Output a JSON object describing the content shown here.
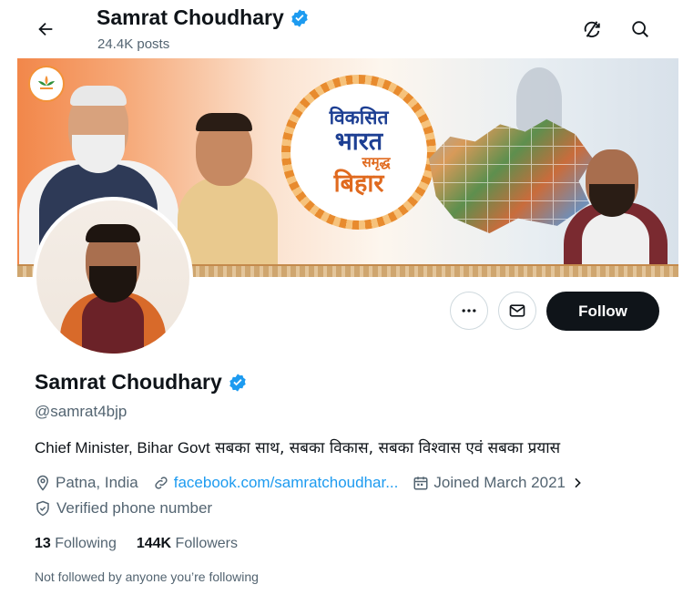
{
  "header": {
    "back_icon": "arrow-left-icon",
    "title": "Samrat Choudhary",
    "posts": "24.4K posts",
    "sync_icon": "sync-off-icon",
    "search_icon": "search-icon"
  },
  "banner": {
    "ring_line1": "विकसित",
    "ring_line2": "भारत",
    "ring_line3": "समृद्ध",
    "ring_line4": "बिहार",
    "logo_icon": "lotus-logo-icon"
  },
  "actions": {
    "more_icon": "more-dots-icon",
    "message_icon": "mail-icon",
    "follow_label": "Follow"
  },
  "profile": {
    "name": "Samrat Choudhary",
    "verified_icon": "verified-badge-icon",
    "handle": "@samrat4bjp",
    "bio_prefix": "Chief Minister, Bihar Govt",
    "bio_hindi": " सबका साथ, सबका विकास, सबका विश्वास एवं सबका प्रयास",
    "location": "Patna, India",
    "website": "facebook.com/samratchoudhar...",
    "joined": "Joined March 2021",
    "verified_phone": "Verified phone number"
  },
  "stats": {
    "following_count": "13",
    "following_label": "Following",
    "followers_count": "144K",
    "followers_label": "Followers"
  },
  "note": "Not followed by anyone you’re following",
  "colors": {
    "accent": "#1d9bf0",
    "text": "#0f1419",
    "muted": "#536471",
    "follow_bg": "#0f1419"
  }
}
